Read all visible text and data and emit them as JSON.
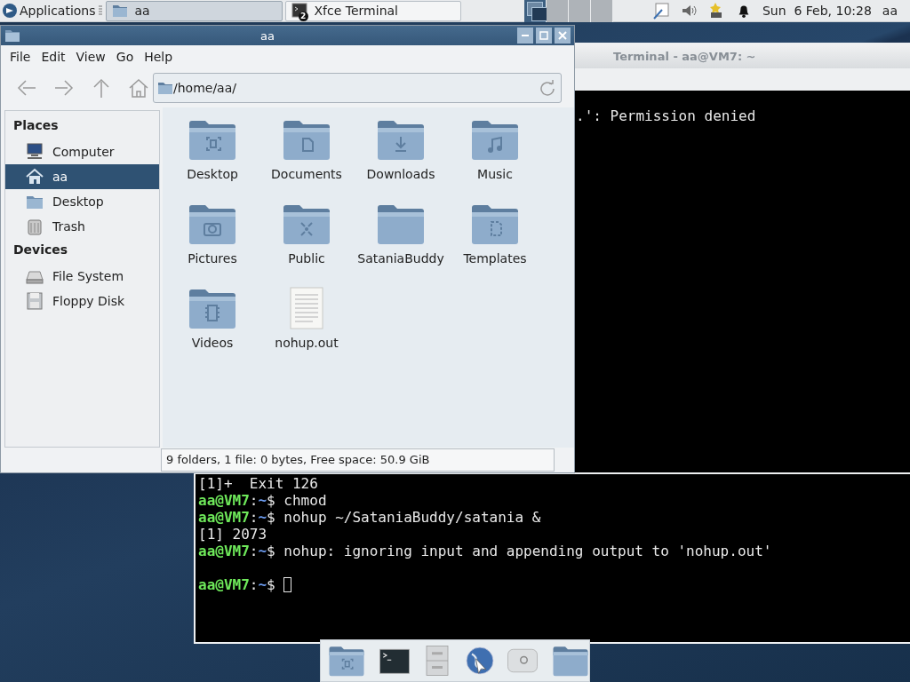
{
  "panel": {
    "menu": "Applications",
    "tasks": [
      {
        "label": "aa",
        "kind": "folder",
        "selected": true
      },
      {
        "label": "Xfce Terminal",
        "kind": "terminal",
        "badge": "2",
        "selected": false
      }
    ],
    "workspaces": [
      {
        "selected": true
      },
      {
        "selected": false
      },
      {
        "selected": false
      },
      {
        "selected": false
      }
    ],
    "clock": "Sun  6 Feb, 10:28",
    "user": "aa"
  },
  "terminal_back": {
    "title": "Terminal - aa@VM7: ~",
    "lines": [
      ".': Permission denied"
    ]
  },
  "terminal_front": {
    "lines": [
      {
        "kind": "output",
        "text": "[1]+  Exit 126"
      },
      {
        "kind": "prompt",
        "user_host": "aa@VM7",
        "separator": ":",
        "path": "~",
        "symbol": "$",
        "command": "chmod"
      },
      {
        "kind": "prompt",
        "user_host": "aa@VM7",
        "separator": ":",
        "path": "~",
        "symbol": "$",
        "command": "nohup ~/SataniaBuddy/satania &"
      },
      {
        "kind": "output",
        "text": "[1] 2073"
      },
      {
        "kind": "prompt",
        "user_host": "aa@VM7",
        "separator": ":",
        "path": "~",
        "symbol": "$",
        "command": "nohup: ignoring input and appending output to 'nohup.out'"
      },
      {
        "kind": "blank"
      },
      {
        "kind": "prompt",
        "user_host": "aa@VM7",
        "separator": ":",
        "path": "~",
        "symbol": "$",
        "cursor": true
      }
    ]
  },
  "file_manager": {
    "title": "aa",
    "menu": [
      "File",
      "Edit",
      "View",
      "Go",
      "Help"
    ],
    "location": "/home/aa/",
    "sidebar": [
      {
        "heading": "Places",
        "items": [
          {
            "label": "Computer",
            "kind": "computer",
            "selected": false
          },
          {
            "label": "aa",
            "kind": "home",
            "selected": true
          },
          {
            "label": "Desktop",
            "kind": "desktop",
            "selected": false
          },
          {
            "label": "Trash",
            "kind": "trash",
            "selected": false
          }
        ]
      },
      {
        "heading": "Devices",
        "items": [
          {
            "label": "File System",
            "kind": "drive",
            "selected": false
          },
          {
            "label": "Floppy Disk",
            "kind": "floppy",
            "selected": false
          }
        ]
      }
    ],
    "files": [
      {
        "name": "Desktop",
        "kind": "folder"
      },
      {
        "name": "Documents",
        "kind": "folder"
      },
      {
        "name": "Downloads",
        "kind": "folder"
      },
      {
        "name": "Music",
        "kind": "folder"
      },
      {
        "name": "Pictures",
        "kind": "folder"
      },
      {
        "name": "Public",
        "kind": "folder"
      },
      {
        "name": "SataniaBuddy",
        "kind": "folder"
      },
      {
        "name": "Templates",
        "kind": "folder"
      },
      {
        "name": "Videos",
        "kind": "folder"
      },
      {
        "name": "nohup.out",
        "kind": "document"
      }
    ],
    "status": "9 folders, 1 file: 0 bytes, Free space: 50.9 GiB"
  }
}
